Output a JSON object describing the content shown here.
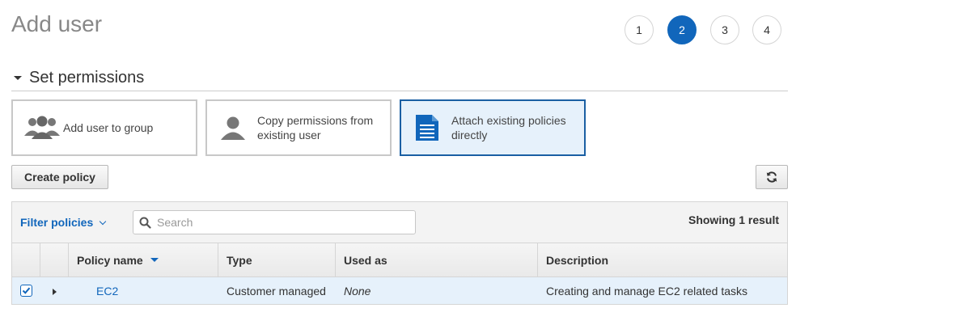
{
  "page": {
    "title": "Add user"
  },
  "steps": [
    {
      "label": "1",
      "active": false
    },
    {
      "label": "2",
      "active": true
    },
    {
      "label": "3",
      "active": false
    },
    {
      "label": "4",
      "active": false
    }
  ],
  "section": {
    "title": "Set permissions"
  },
  "options": {
    "add_to_group": {
      "label": "Add user to group",
      "icon": "user-group-icon"
    },
    "copy_permissions": {
      "label_line1": "Copy permissions from",
      "label_line2": "existing user",
      "icon": "user-icon"
    },
    "attach_policies": {
      "label_line1": "Attach existing policies",
      "label_line2": "directly",
      "icon": "document-icon",
      "selected": true
    }
  },
  "buttons": {
    "create_policy": "Create policy",
    "refresh_icon": "refresh-icon"
  },
  "table": {
    "filter_label": "Filter policies",
    "search_placeholder": "Search",
    "result_text": "Showing 1 result",
    "columns": {
      "policy_name": "Policy name",
      "type": "Type",
      "used_as": "Used as",
      "description": "Description"
    },
    "rows": [
      {
        "checked": true,
        "policy_name": "EC2",
        "type": "Customer managed",
        "used_as": "None",
        "description": "Creating and manage EC2 related tasks"
      }
    ]
  },
  "colors": {
    "accent": "#1166bb",
    "selected_bg": "#e6f1fb",
    "selected_border": "#1a5fa3",
    "icon_gray": "#666666"
  }
}
